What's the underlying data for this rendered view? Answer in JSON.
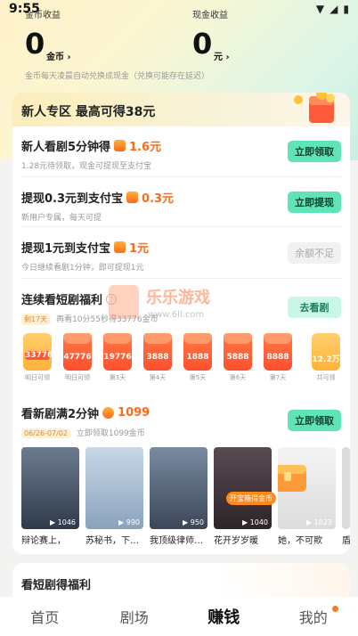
{
  "status": {
    "time": "9:55"
  },
  "balance": {
    "gold_label": "金币收益",
    "cash_label": "现金收益",
    "gold_value": "0",
    "gold_unit": "金币 ›",
    "cash_value": "0",
    "cash_unit": "元 ›",
    "note": "金币每天凌晨自动兑换成现金（兑换可能存在延迟）"
  },
  "newbie": {
    "title": "新人专区 最高可得38元",
    "rows": [
      {
        "title": "新人看剧5分钟得",
        "amount": "1.6元",
        "sub": "1.28元待领取，现金可提现至支付宝",
        "button": "立即领取"
      },
      {
        "title": "提现0.3元到支付宝",
        "amount": "0.3元",
        "sub": "新用户专属，每天可提",
        "button": "立即提现"
      },
      {
        "title": "提现1元到支付宝",
        "amount": "1元",
        "sub": "今日继续看剧1分钟，即可提现1元",
        "button": "余额不足"
      }
    ]
  },
  "streak": {
    "title": "连续看短剧福利",
    "tag": "剩17天",
    "sub": "再看10分55秒得33776金币",
    "button": "去看剧",
    "days": [
      {
        "value": "33776",
        "label": "明日可领"
      },
      {
        "value": "47776",
        "label": "明日可领"
      },
      {
        "value": "19776",
        "label": "第3天"
      },
      {
        "value": "3888",
        "label": "第4天"
      },
      {
        "value": "1888",
        "label": "第5天"
      },
      {
        "value": "5888",
        "label": "第6天"
      },
      {
        "value": "8888",
        "label": "第7天"
      },
      {
        "value": "12.2万",
        "label": "共可领"
      }
    ]
  },
  "watch": {
    "title": "看新剧满2分钟",
    "amount": "1099",
    "tag": "06/26-07/02",
    "sub": "立即领取1099金币",
    "button": "立即领取",
    "chest_badge": "开宝箱得金币",
    "videos": [
      {
        "caption": "辩论赛上，",
        "count": "▶ 1046"
      },
      {
        "caption": "苏秘书，下…",
        "count": "▶ 990"
      },
      {
        "caption": "我顶级律师…",
        "count": "▶ 950"
      },
      {
        "caption": "花开岁岁暖",
        "count": "▶ 1040"
      },
      {
        "caption": "她，不可欺",
        "count": "▶ 1023"
      },
      {
        "caption": "盾",
        "count": ""
      }
    ]
  },
  "section2": {
    "title": "看短剧得福利"
  },
  "watermark": {
    "text": "乐乐游戏",
    "url": "www.6ll.com"
  },
  "tabs": [
    {
      "label": "首页"
    },
    {
      "label": "剧场"
    },
    {
      "label": "赚钱"
    },
    {
      "label": "我的"
    }
  ],
  "colors": {
    "accent": "#5fe3b8",
    "orange": "#ff6a1a"
  }
}
